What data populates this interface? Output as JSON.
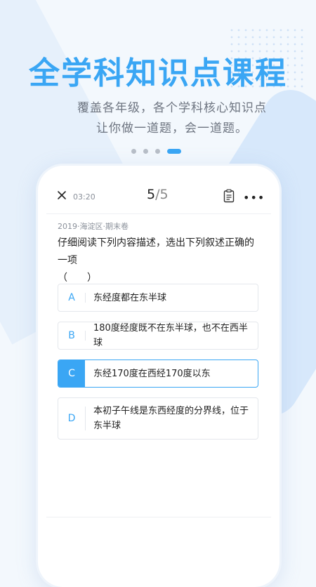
{
  "promo": {
    "headline": "全学科知识点课程",
    "subtitle_line1": "覆盖各年级，各个学科核心知识点",
    "subtitle_line2": "让你做一道题，会一道题。",
    "page_indicator": {
      "total": 4,
      "active": 4
    }
  },
  "quiz": {
    "timer": "03:20",
    "current": "5",
    "total": "/5",
    "source": "2019·海淀区·期末卷",
    "question_line1": "仔细阅读下列内容描述，选出下列叙述正确的一项",
    "question_line2": "（　　）",
    "options": [
      {
        "letter": "A",
        "text": "东经度都在东半球"
      },
      {
        "letter": "B",
        "text": "180度经度既不在东半球，也不在西半球"
      },
      {
        "letter": "C",
        "text": "东经170度在西经170度以东"
      },
      {
        "letter": "D",
        "text": "本初子午线是东西经度的分界线，位于东半球"
      }
    ],
    "selected": "C"
  },
  "icons": {
    "close": "close-icon",
    "answer_sheet": "answer-sheet-icon",
    "more": "more-icon"
  },
  "colors": {
    "accent": "#3aa6f4",
    "background": "#f3f8fd",
    "text": "#222222",
    "muted": "#8a909a"
  }
}
